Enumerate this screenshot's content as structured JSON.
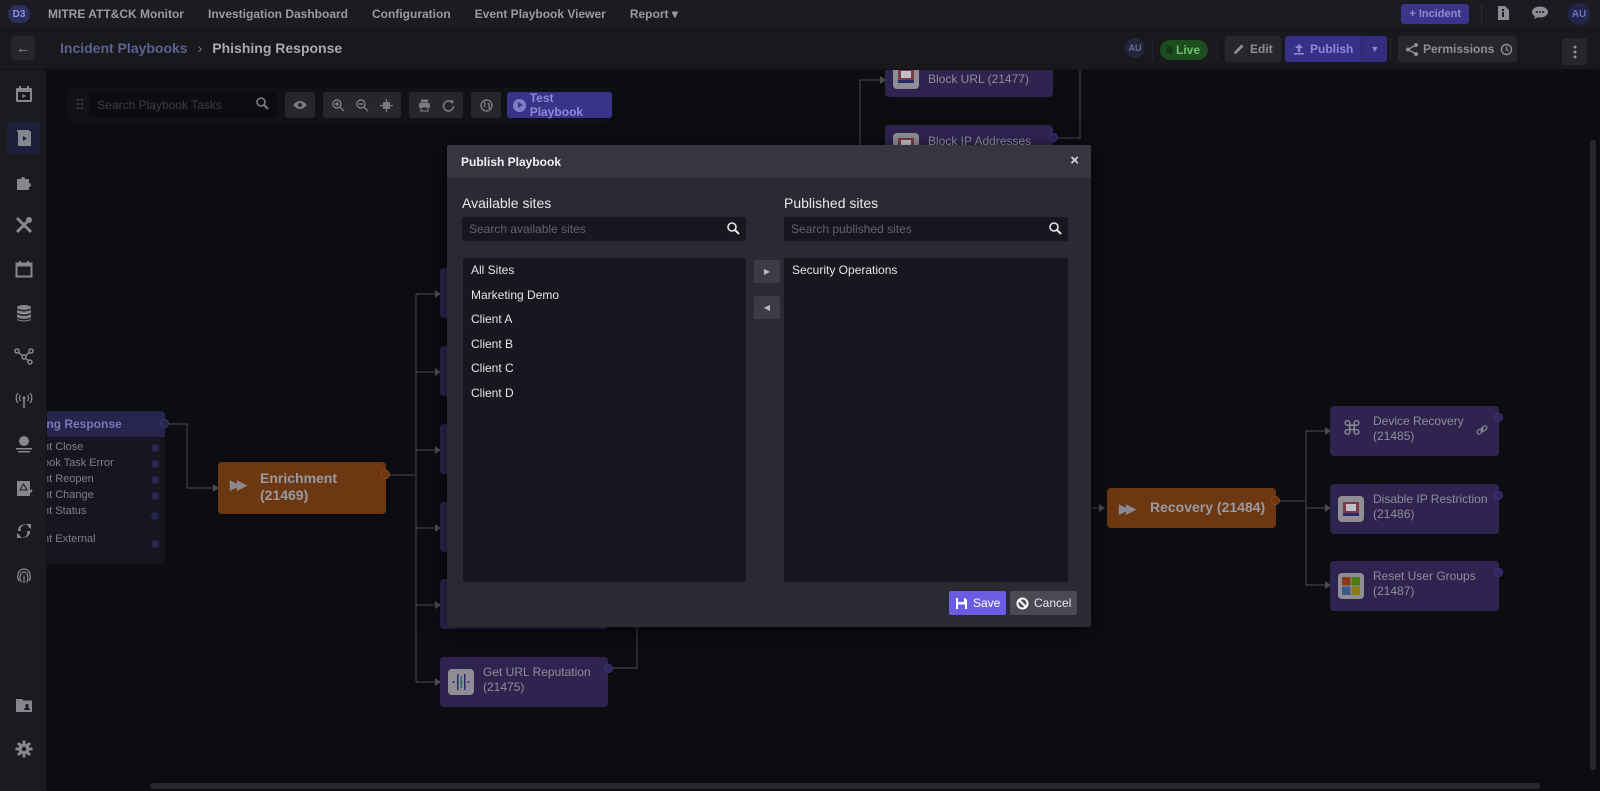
{
  "topnav": {
    "logo": "D3",
    "links": [
      "MITRE ATT&CK Monitor",
      "Investigation Dashboard",
      "Configuration",
      "Event Playbook Viewer",
      "Report ▾"
    ],
    "incident_button": "+ Incident",
    "info_icon": "ℹ",
    "chat_icon": "💬",
    "user_initials": "AU"
  },
  "subheader": {
    "back_icon": "←",
    "breadcrumb": {
      "parent": "Incident Playbooks",
      "separator": "›",
      "current": "Phishing Response"
    },
    "user_initials": "AU",
    "status": "Live",
    "edit_label": "Edit",
    "publish_label": "Publish",
    "permissions_label": "Permissions"
  },
  "toolbar": {
    "search_placeholder": "Search Playbook Tasks",
    "test_button": "Test Playbook"
  },
  "flow": {
    "trigger": {
      "title": "ing Response",
      "rows": [
        "nt Close",
        "ook Task Error",
        "nt Reopen",
        "nt Change",
        "nt Status",
        "nt External"
      ]
    },
    "enrichment": {
      "title": "Enrichment",
      "id": "(21469)"
    },
    "block_url": {
      "title": "Block URL (21477)"
    },
    "block_ip": {
      "title": "Block IP Addresses"
    },
    "get_url_reputation": {
      "title": "Get URL Reputation",
      "id": "(21475)"
    },
    "recovery": {
      "title": "Recovery (21484)"
    },
    "device_recovery": {
      "title": "Device Recovery",
      "id": "(21485)"
    },
    "disable_ip_restriction": {
      "title": "Disable IP Restriction",
      "id": "(21486)"
    },
    "reset_user_groups": {
      "title": "Reset User Groups",
      "id": "(21487)"
    }
  },
  "modal": {
    "title": "Publish Playbook",
    "close_icon": "×",
    "available": {
      "title": "Available sites",
      "search_placeholder": "Search available sites",
      "items": [
        "All Sites",
        "Marketing Demo",
        "Client A",
        "Client B",
        "Client C",
        "Client D"
      ]
    },
    "published": {
      "title": "Published sites",
      "search_placeholder": "Search published sites",
      "items": [
        "Security Operations"
      ]
    },
    "move_right_icon": "▶",
    "move_left_icon": "◀",
    "save_label": "Save",
    "cancel_label": "Cancel"
  },
  "colors": {
    "accent": "#6c5ce1",
    "publish": "#373089",
    "live": "#1d4d1f",
    "node_purple": "#2f2450",
    "node_orange": "#6c3711"
  }
}
